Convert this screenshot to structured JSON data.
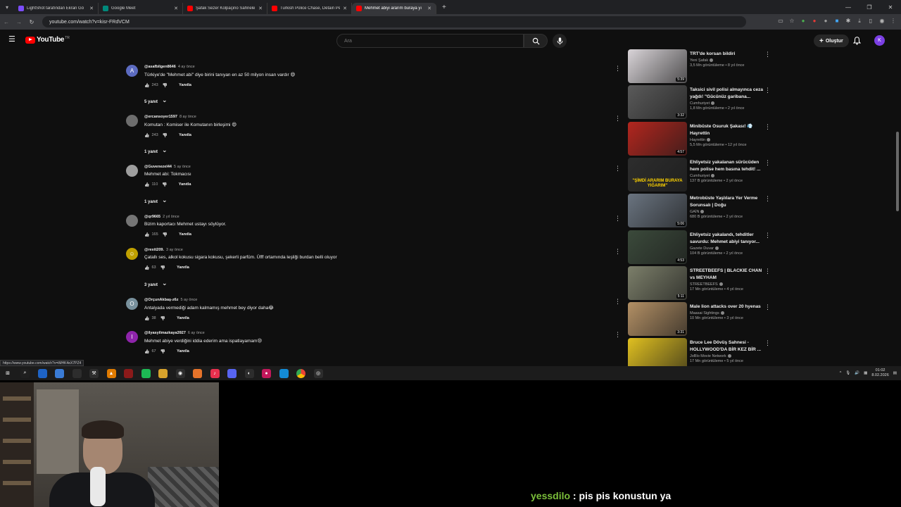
{
  "browser": {
    "tabs": [
      {
        "label": "LightShot tarafından Ekran Gö",
        "color": "#7c4dff"
      },
      {
        "label": "Google Meet",
        "color": "#00897b"
      },
      {
        "label": "Şafak Sezer Kolpaçino Sahnele",
        "color": "#ff0000"
      },
      {
        "label": "Turkish Police Chase, Detain Pe",
        "color": "#ff0000"
      },
      {
        "label": "Mehmet abiyi ararım buraya yı",
        "color": "#ff0000"
      }
    ],
    "new_tab": "+",
    "url": "youtube.com/watch?v=kisr-FRdVCM",
    "status_url": "https://www.youtube.com/watch?v=iMHK4eX7PZ4"
  },
  "youtube": {
    "logo_text": "YouTube",
    "logo_region": "TR",
    "search_placeholder": "Ara",
    "create_label": "Oluştur",
    "avatar_letter": "K"
  },
  "comments": [
    {
      "author": "@asafbilgen8646",
      "time": "4 ay önce",
      "text": "Türkiye'de \"Mehmet abi\" diye birini tanıyan en az 50 milyon insan vardır 😄",
      "likes": "243",
      "reply": "Yanıtla",
      "replies": "5 yanıt",
      "avatar_letter": "A",
      "avatar_color": "#5c6bc0"
    },
    {
      "author": "@ercansoyer1597",
      "time": "8 ay önce",
      "text": "Komutan : Komiser ile Komutanın birleşimi 😄",
      "likes": "243",
      "reply": "Yanıtla",
      "replies": "1 yanıt",
      "avatar_letter": "",
      "avatar_color": "#6d6d6d"
    },
    {
      "author": "@Guvenezel44",
      "time": "5 ay önce",
      "text": "Mehmet abi: Tokmacısı",
      "likes": "110",
      "reply": "Yanıtla",
      "replies": "1 yanıt",
      "avatar_letter": "",
      "avatar_color": "#9e9e9e"
    },
    {
      "author": "@qr9665",
      "time": "2 yıl önce",
      "text": "Bizim kaportacı Mehmet ustayı söylüyor.",
      "likes": "165",
      "reply": "Yanıtla",
      "replies": "",
      "avatar_letter": "",
      "avatar_color": "#757575"
    },
    {
      "author": "@restt209.",
      "time": "3 ay önce",
      "text": "Çatallı ses, alkol kokusu sigara kokusu, şekerli parfüm. Üfff ortamında leşliği burdan belli oluyor",
      "likes": "63",
      "reply": "Yanıtla",
      "replies": "3 yanıt",
      "avatar_letter": "☺",
      "avatar_color": "#c0a000"
    },
    {
      "author": "@OrçunAkbaş-z6z",
      "time": "5 ay önce",
      "text": "Antalyada vermediği adam kalmamış mehmet bey diyor daha😂",
      "likes": "38",
      "reply": "Yanıtla",
      "replies": "",
      "avatar_letter": "O",
      "avatar_color": "#78909c"
    },
    {
      "author": "@ilyasyilmazkaya3927",
      "time": "6 ay önce",
      "text": "Mehmet abiye verdiğini iddia ederim ama ispatlayamam😢",
      "likes": "67",
      "reply": "Yanıtla",
      "replies": "",
      "avatar_letter": "I",
      "avatar_color": "#8e24aa"
    }
  ],
  "sidebar_videos": [
    {
      "title": "TRT'de korsan bildiri",
      "channel": "Yeni Şafak",
      "stats": "3,5 Mn görüntüleme • 8 yıl önce",
      "duration": "5:39",
      "thumb_color": "#d9d4d8"
    },
    {
      "title": "Taksici sivil polisi almayınca ceza yağdı! \"Gücünüz garibana...",
      "channel": "Cumhuriyet",
      "stats": "1,8 Mn görüntüleme • 2 yıl önce",
      "duration": "3:32",
      "thumb_color": "#5a5a5a"
    },
    {
      "title": "Minibüste Osuruk Şakası! 💨 Hayrettin",
      "channel": "Hayrettin",
      "stats": "5,5 Mn görüntüleme • 12 yıl önce",
      "duration": "4:57",
      "thumb_color": "#b3261e"
    },
    {
      "title": "Ehliyetsiz yakalanan sürücüden hem polise hem basına tehdit! ...",
      "channel": "Cumhuriyet",
      "stats": "137 B görüntüleme • 2 yıl önce",
      "duration": "",
      "thumb_color": "#2d2d2d",
      "thumb_text": "\"ŞİMDİ ARARIM BURAYA YIĞARIM\""
    },
    {
      "title": "Metrobüste Yaşlılara Yer Verme Sorunsalı | Doğu",
      "channel": "GAİN",
      "stats": "680 B görüntüleme • 2 yıl önce",
      "duration": "5:06",
      "thumb_color": "#6a7480"
    },
    {
      "title": "Ehliyetsiz yakalandı, tehditler savurdu: Mehmet abiyi tanıyor...",
      "channel": "Gazete Duvar",
      "stats": "104 B görüntüleme • 2 yıl önce",
      "duration": "4:53",
      "thumb_color": "#3b4a3b"
    },
    {
      "title": "STREETBEEFS | BLACKIE CHAN vs MEYHAM",
      "channel": "STREETBEEFS",
      "stats": "17 Mn görüntüleme • 4 yıl önce",
      "duration": "5:11",
      "thumb_color": "#7c7f6a"
    },
    {
      "title": "Male lion attacks over 20 hyenas",
      "channel": "Maasai Sightings",
      "stats": "10 Mn görüntüleme • 3 yıl önce",
      "duration": "3:31",
      "thumb_color": "#b39065"
    },
    {
      "title": "Bruce Lee Dövüş Sahnesi - HOLLYWOOD'DA BİR KEZ BİR ...",
      "channel": "JoBlo Movie Network",
      "stats": "17 Mn görüntüleme • 5 yıl önce",
      "duration": "",
      "thumb_color": "#e0c020"
    }
  ],
  "taskbar": {
    "icons": [
      {
        "name": "windows-start-icon",
        "color": "#1f1f1f",
        "glyph": "⊞"
      },
      {
        "name": "search-icon",
        "color": "#1f1f1f",
        "glyph": "⌕"
      },
      {
        "name": "app-icon",
        "color": "#1e63c5",
        "glyph": ""
      },
      {
        "name": "copilot-icon",
        "color": "#3a7bd5",
        "glyph": ""
      },
      {
        "name": "calendar-icon",
        "color": "#2d2d2d",
        "glyph": ""
      },
      {
        "name": "tool-icon",
        "color": "#2d2d2d",
        "glyph": "⚒"
      },
      {
        "name": "vlc-icon",
        "color": "#e07b00",
        "glyph": "▲"
      },
      {
        "name": "app2-icon",
        "color": "#8b1a1a",
        "glyph": ""
      },
      {
        "name": "spotify-icon",
        "color": "#1db954",
        "glyph": ""
      },
      {
        "name": "folder-icon",
        "color": "#d8a32c",
        "glyph": ""
      },
      {
        "name": "podcast-icon",
        "color": "#2d2d2d",
        "glyph": "◉"
      },
      {
        "name": "app3-icon",
        "color": "#e5732a",
        "glyph": ""
      },
      {
        "name": "music-icon",
        "color": "#e8304e",
        "glyph": "♪"
      },
      {
        "name": "discord-icon",
        "color": "#5865f2",
        "glyph": ""
      },
      {
        "name": "media-icon",
        "color": "#2d2d2d",
        "glyph": "◐"
      },
      {
        "name": "app4-icon",
        "color": "#c2185b",
        "glyph": "●"
      },
      {
        "name": "edge-icon",
        "color": "#138bd6",
        "glyph": ""
      },
      {
        "name": "chrome-icon",
        "color": "#e94235",
        "glyph": ""
      },
      {
        "name": "app5-icon",
        "color": "#2d2d2d",
        "glyph": "◎"
      }
    ],
    "time": "01:02",
    "date": "8.02.2026"
  },
  "overlay": {
    "chat_user": "yessdilo",
    "chat_text": ": pis pis konustun ya"
  }
}
